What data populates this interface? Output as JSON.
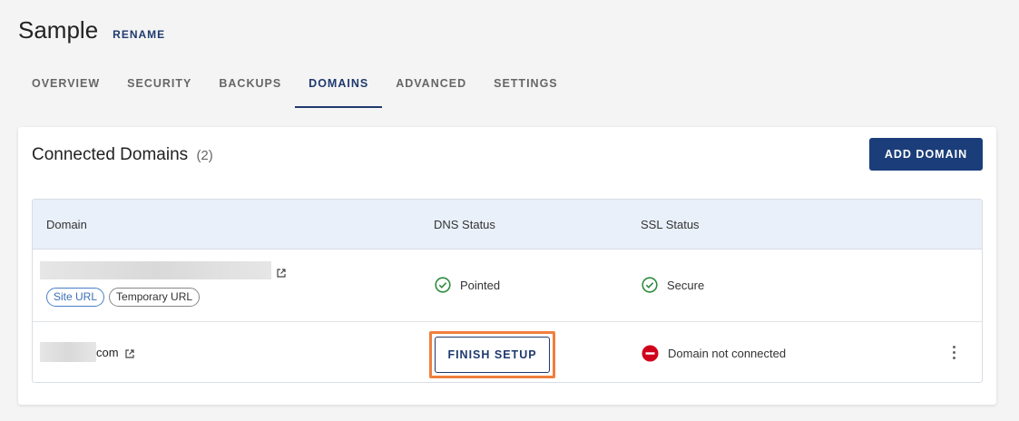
{
  "header": {
    "site_name": "Sample",
    "rename_label": "RENAME"
  },
  "tabs": [
    {
      "label": "OVERVIEW",
      "active": false
    },
    {
      "label": "SECURITY",
      "active": false
    },
    {
      "label": "BACKUPS",
      "active": false
    },
    {
      "label": "DOMAINS",
      "active": true
    },
    {
      "label": "ADVANCED",
      "active": false
    },
    {
      "label": "SETTINGS",
      "active": false
    }
  ],
  "card": {
    "title": "Connected Domains",
    "count": "(2)",
    "add_button_label": "ADD DOMAIN"
  },
  "table": {
    "columns": [
      "Domain",
      "DNS Status",
      "SSL Status"
    ],
    "rows": [
      {
        "domain_suffix": "",
        "tags": [
          "Site URL",
          "Temporary URL"
        ],
        "dns_status": "Pointed",
        "ssl_status": "Secure"
      },
      {
        "domain_suffix": "com",
        "dns_action_label": "FINISH SETUP",
        "ssl_status": "Domain not connected"
      }
    ]
  },
  "colors": {
    "accent": "#1b3e7a",
    "success": "#2e8b3e",
    "error": "#d0021b",
    "highlight": "#f07f3c",
    "site_url_tag": "#3a6fb8"
  },
  "icons": {
    "external_link": "external-link-icon",
    "check": "check-circle-icon",
    "error": "minus-circle-icon",
    "more": "more-vertical-icon"
  }
}
